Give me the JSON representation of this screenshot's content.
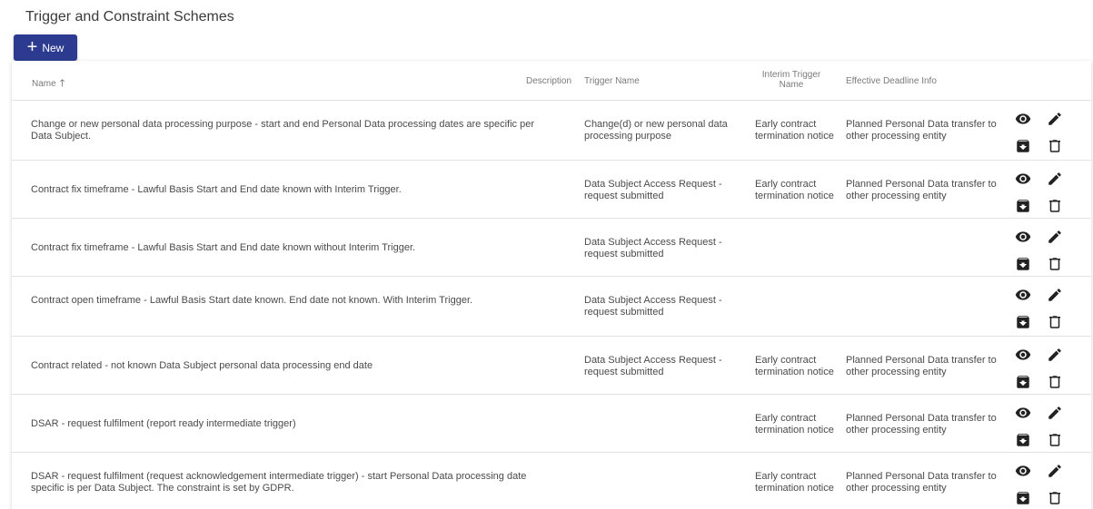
{
  "page": {
    "title": "Trigger and Constraint Schemes",
    "new_button_label": "New"
  },
  "table": {
    "columns": {
      "name": "Name",
      "description": "Description",
      "trigger_name": "Trigger Name",
      "interim_trigger_name": "Interim Trigger Name",
      "effective_deadline_info": "Effective Deadline Info"
    },
    "sort": {
      "column": "name",
      "direction": "ascending"
    },
    "rows": [
      {
        "name": "Change or new personal data processing purpose - start and end Personal Data processing dates are specific per Data Subject.",
        "trigger_name": "Change(d) or new personal data processing purpose",
        "interim_trigger_name": "Early contract termination notice",
        "effective_deadline_info": "Planned Personal Data transfer to other processing entity"
      },
      {
        "name": "Contract fix timeframe - Lawful Basis Start and End date known with Interim Trigger.",
        "trigger_name": "Data Subject Access Request - request submitted",
        "interim_trigger_name": "Early contract termination notice",
        "effective_deadline_info": "Planned Personal Data transfer to other processing entity"
      },
      {
        "name": "Contract fix timeframe - Lawful Basis Start and End date known without Interim Trigger.",
        "trigger_name": "Data Subject Access Request - request submitted",
        "interim_trigger_name": "",
        "effective_deadline_info": ""
      },
      {
        "name": "Contract open timeframe - Lawful Basis Start date known. End date not known. With Interim Trigger.",
        "trigger_name": "Data Subject Access Request - request submitted",
        "interim_trigger_name": "",
        "effective_deadline_info": ""
      },
      {
        "name": "Contract related - not known Data Subject personal data processing end date",
        "trigger_name": "Data Subject Access Request - request submitted",
        "interim_trigger_name": "Early contract termination notice",
        "effective_deadline_info": "Planned Personal Data transfer to other processing entity"
      },
      {
        "name": "DSAR - request fulfilment (report ready intermediate trigger)",
        "trigger_name": "",
        "interim_trigger_name": "Early contract termination notice",
        "effective_deadline_info": "Planned Personal Data transfer to other processing entity"
      },
      {
        "name": "DSAR - request fulfilment (request acknowledgement intermediate trigger) - start Personal Data processing date specific is per Data Subject. The constraint is set by GDPR.",
        "trigger_name": "",
        "interim_trigger_name": "Early contract termination notice",
        "effective_deadline_info": "Planned Personal Data transfer to other processing entity"
      }
    ],
    "row_actions": [
      "view-icon",
      "edit-icon",
      "archive-icon",
      "delete-icon"
    ]
  },
  "colors": {
    "primary": "#2c3b8f",
    "border": "#e2e2e2",
    "header_text": "#7a7a7a",
    "body_text": "#4a4a4a"
  }
}
